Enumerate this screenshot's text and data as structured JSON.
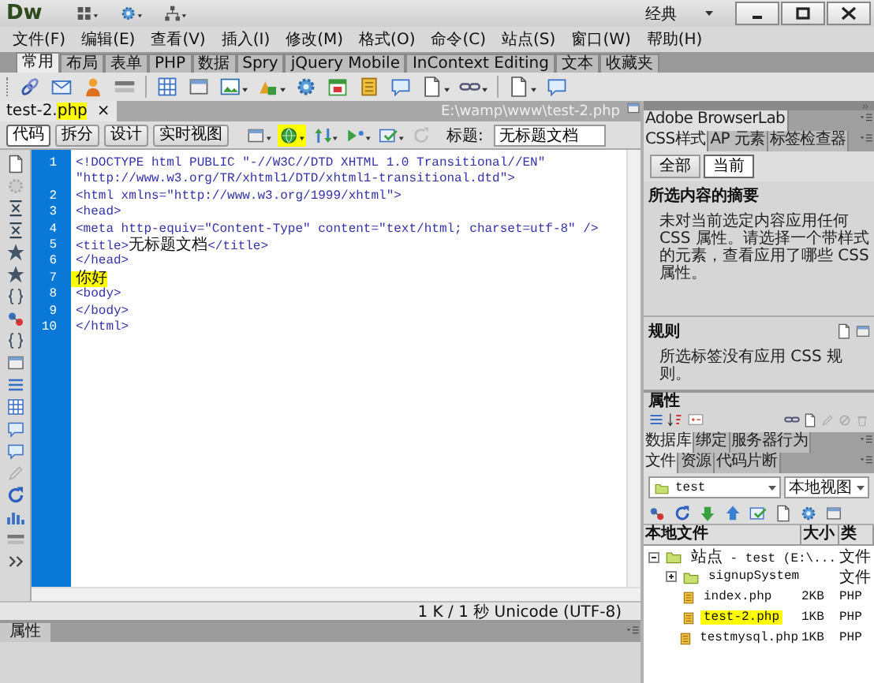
{
  "app": {
    "logo": "Dw",
    "workspace": "经典"
  },
  "menu": [
    "文件(F)",
    "编辑(E)",
    "查看(V)",
    "插入(I)",
    "修改(M)",
    "格式(O)",
    "命令(C)",
    "站点(S)",
    "窗口(W)",
    "帮助(H)"
  ],
  "insert_tabs": [
    {
      "label": "常用",
      "selected": true
    },
    {
      "label": "布局",
      "selected": false
    },
    {
      "label": "表单",
      "selected": false
    },
    {
      "label": "PHP",
      "selected": false
    },
    {
      "label": "数据",
      "selected": false
    },
    {
      "label": "Spry",
      "selected": false
    },
    {
      "label": "jQuery Mobile",
      "selected": false
    },
    {
      "label": "InContext Editing",
      "selected": false
    },
    {
      "label": "文本",
      "selected": false
    },
    {
      "label": "收藏夹",
      "selected": false
    }
  ],
  "document": {
    "tab": {
      "parts": [
        {
          "text": "test-2.",
          "highlighted": false
        },
        {
          "text": "php",
          "highlighted": true
        }
      ],
      "close": "×"
    },
    "path": "E:\\wamp\\www\\test-2.php"
  },
  "view_buttons": [
    {
      "label": "代码",
      "selected": true
    },
    {
      "label": "拆分",
      "selected": false
    },
    {
      "label": "设计",
      "selected": false
    },
    {
      "label": "实时视图",
      "selected": false
    }
  ],
  "doc_toolbar_icons": [
    {
      "highlighted": false
    },
    {
      "highlighted": true
    },
    {
      "highlighted": false
    },
    {
      "highlighted": false
    },
    {
      "highlighted": false
    },
    {
      "highlighted": false
    }
  ],
  "title_field": {
    "label": "标题:",
    "value": "无标题文档"
  },
  "code_lines": [
    {
      "number": "1",
      "text": "<!DOCTYPE html PUBLIC \"-//W3C//DTD XHTML 1.0 Transitional//EN\"",
      "highlighted": false
    },
    {
      "text": "\"http://www.w3.org/TR/xhtml1/DTD/xhtml1-transitional.dtd\">",
      "highlighted": false
    },
    {
      "number": "2",
      "text": "<html xmlns=\"http://www.w3.org/1999/xhtml\">",
      "highlighted": false
    },
    {
      "number": "3",
      "text": "<head>",
      "highlighted": false
    },
    {
      "number": "4",
      "text": "<meta http-equiv=\"Content-Type\" content=\"text/html; charset=utf-8\" />",
      "highlighted": false
    },
    {
      "number": "5",
      "text": "<title>无标题文档</title>",
      "highlighted": false
    },
    {
      "number": "6",
      "text": "</head>",
      "highlighted": false
    },
    {
      "number": "7",
      "text": "你好",
      "highlighted": true
    },
    {
      "number": "8",
      "text": "<body>",
      "highlighted": false
    },
    {
      "number": "9",
      "text": "</body>",
      "highlighted": false
    },
    {
      "number": "10",
      "text": "</html>",
      "highlighted": false
    }
  ],
  "status": "1 K / 1 秒 Unicode (UTF-8)",
  "properties_panel": {
    "tab": "属性"
  },
  "right_panel": {
    "browserlab": "Adobe BrowserLab",
    "css_tabs": [
      {
        "label": "CSS样式",
        "selected": true
      },
      {
        "label": "AP 元素",
        "selected": false
      },
      {
        "label": "标签检查器",
        "selected": false
      }
    ],
    "mode_buttons": [
      {
        "label": "全部",
        "selected": false
      },
      {
        "label": "当前",
        "selected": true
      }
    ],
    "summary": {
      "heading": "所选内容的摘要",
      "text": "未对当前选定内容应用任何 CSS 属性。请选择一个带样式的元素，查看应用了哪些 CSS 属性。"
    },
    "rules": {
      "heading": "规则",
      "text": "所选标签没有应用 CSS 规则。"
    },
    "properties": {
      "heading": "属性"
    },
    "data_tabs": [
      {
        "label": "数据库",
        "selected": true
      },
      {
        "label": "绑定",
        "selected": false
      },
      {
        "label": "服务器行为",
        "selected": false
      }
    ],
    "file_tabs": [
      {
        "label": "文件",
        "selected": true
      },
      {
        "label": "资源",
        "selected": false
      },
      {
        "label": "代码片断",
        "selected": false
      }
    ],
    "site_select": "test",
    "view_select": "本地视图",
    "columns": [
      "本地文件",
      "大小",
      "类"
    ],
    "tree": [
      {
        "kind": "site",
        "name": "站点 - test (E:\\...",
        "type": "文件",
        "expanded": true,
        "highlighted": false,
        "children": [
          {
            "kind": "folder",
            "name": "signupSystem",
            "type": "文件",
            "expanded": false,
            "highlighted": false
          },
          {
            "kind": "file",
            "name": "index.php",
            "size": "2KB",
            "type": "PHP",
            "highlighted": false
          },
          {
            "kind": "file",
            "name": "test-2.php",
            "size": "1KB",
            "type": "PHP",
            "highlighted": true
          },
          {
            "kind": "file",
            "name": "testmysql.php",
            "size": "1KB",
            "type": "PHP",
            "highlighted": false
          }
        ]
      }
    ]
  }
}
